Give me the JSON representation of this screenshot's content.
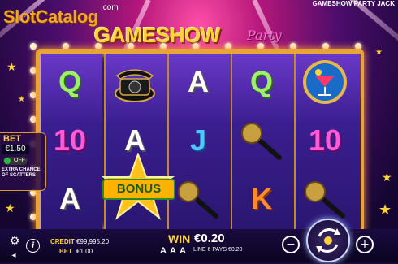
{
  "game": {
    "title": "GAMESHOW PARTY JACK",
    "logo_main": "GAMESHOW",
    "logo_sub": "Party"
  },
  "watermark": {
    "text": "SlotCatalog",
    "suffix": ".com"
  },
  "reels": [
    [
      "Q",
      "10",
      "A"
    ],
    [
      "phone-icon",
      "A",
      "bonus-scatter"
    ],
    [
      "A",
      "J",
      "microphone-icon"
    ],
    [
      "Q",
      "microphone-icon",
      "K"
    ],
    [
      "cocktail-icon",
      "10",
      "microphone-icon"
    ]
  ],
  "symbols": {
    "bonus_label": "BONUS"
  },
  "bet_panel": {
    "title": "BET",
    "value": "€1.50",
    "toggle": "OFF",
    "note": "EXTRA CHANCE OF SCATTERS"
  },
  "footer": {
    "credit_label": "CREDIT",
    "credit_value": "€99,995.20",
    "bet_label": "BET",
    "bet_value": "€1.00",
    "win_label": "WIN",
    "win_value": "€0.20",
    "line_pays": "LINE 6 PAYS €0.20",
    "mini_letters": [
      "A",
      "A",
      "A"
    ]
  },
  "colors": {
    "gold": "#ffd23a",
    "frame": "#e8a437",
    "reel_bg": "#3a1e8f"
  }
}
